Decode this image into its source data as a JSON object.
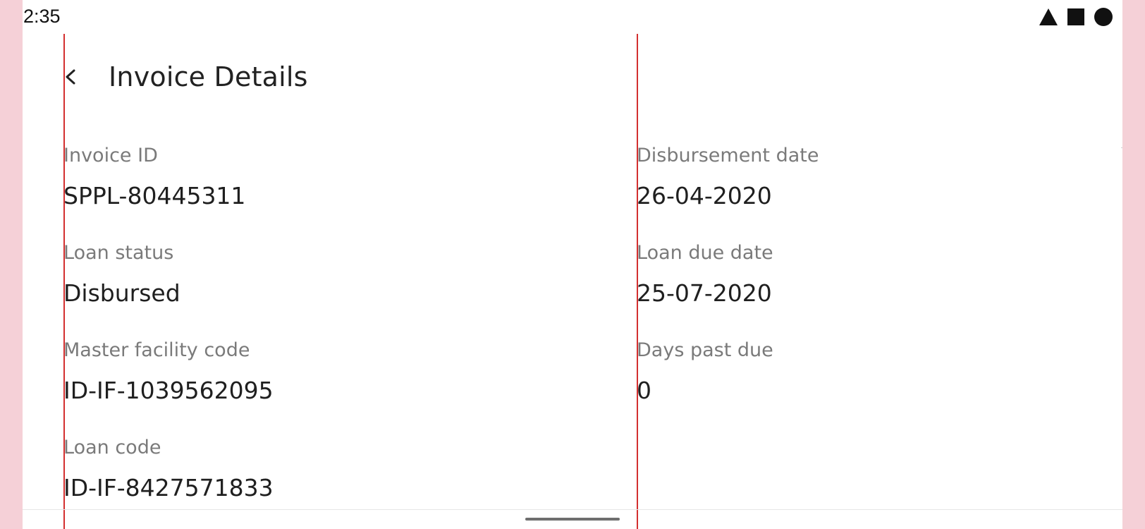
{
  "status_bar": {
    "time": "2:35",
    "icons": [
      "signal-triangle-icon",
      "square-icon",
      "circle-icon"
    ]
  },
  "header": {
    "back_icon": "chevron-left-icon",
    "title": "Invoice Details"
  },
  "fields": {
    "invoice_id": {
      "label": "Invoice ID",
      "value": "SPPL-80445311"
    },
    "loan_status": {
      "label": "Loan status",
      "value": "Disbursed"
    },
    "master_facility_code": {
      "label": "Master facility code",
      "value": "ID-IF-1039562095"
    },
    "loan_code": {
      "label": "Loan code",
      "value": "ID-IF-8427571833"
    },
    "disbursement_date": {
      "label": "Disbursement date",
      "value": "26-04-2020"
    },
    "loan_due_date": {
      "label": "Loan due date",
      "value": "25-07-2020"
    },
    "days_past_due": {
      "label": "Days past due",
      "value": "0"
    }
  },
  "colors": {
    "outer_background": "#f5d0d7",
    "guide_line": "#d32f2f",
    "label_text": "#7a7a7a",
    "value_text": "#1f1f1f"
  }
}
